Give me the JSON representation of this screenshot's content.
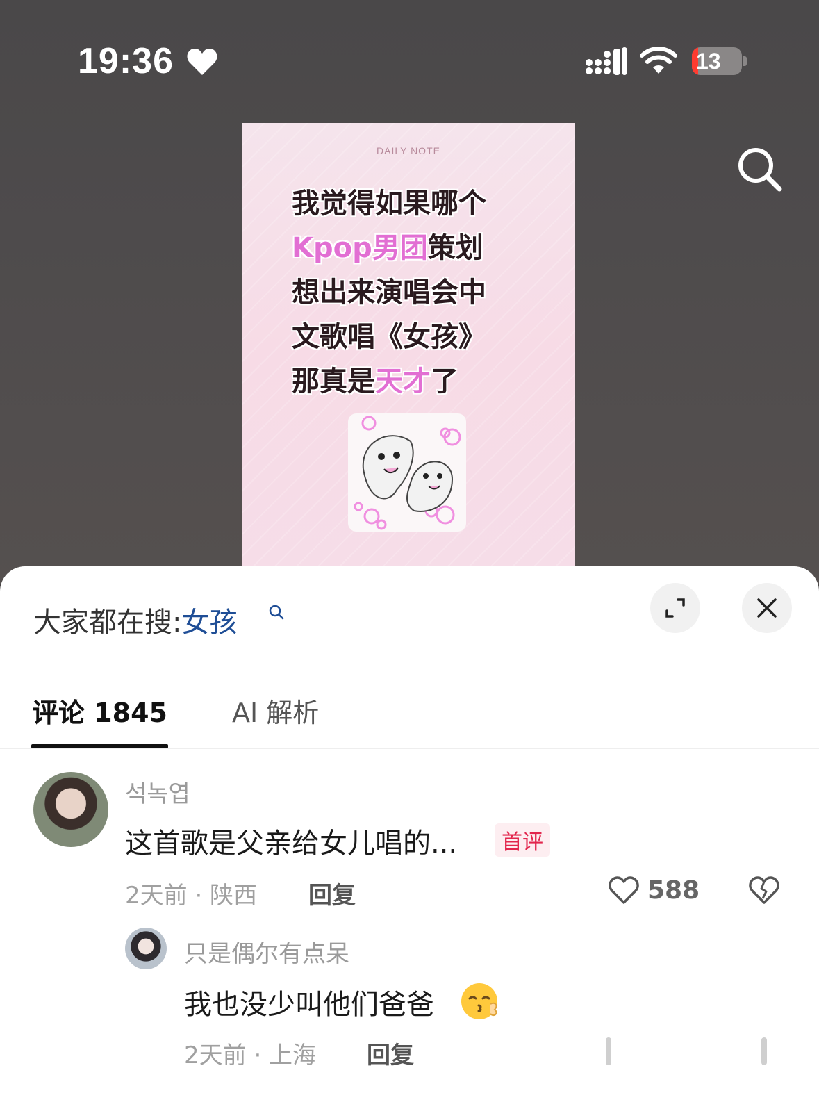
{
  "status_bar": {
    "time": "19:36",
    "battery": "13",
    "battery_level": 0.13
  },
  "post": {
    "header": "DAILY  NOTE",
    "lines": [
      [
        {
          "t": "我觉得如果哪个",
          "h": false
        }
      ],
      [
        {
          "t": "Kpop男团",
          "h": true
        },
        {
          "t": "策划",
          "h": false
        }
      ],
      [
        {
          "t": "想出来演唱会中",
          "h": false
        }
      ],
      [
        {
          "t": "文歌唱《女孩》",
          "h": false
        }
      ],
      [
        {
          "t": "那真是",
          "h": false
        },
        {
          "t": "天才",
          "h": true
        },
        {
          "t": "了",
          "h": false
        }
      ]
    ]
  },
  "sheet": {
    "search_prefix": "大家都在搜:",
    "search_keyword": "女孩",
    "tabs": {
      "comments": "评论 1845",
      "ai": "AI 解析"
    }
  },
  "comments": [
    {
      "user": "석녹엽",
      "text": "这首歌是父亲给女儿唱的...",
      "badge": "首评",
      "meta": "2天前 · 陕西",
      "reply": "回复",
      "likes": "588"
    },
    {
      "user": "只是偶尔有点呆",
      "text": "我也没少叫他们爸爸",
      "meta": "2天前 · 上海",
      "reply": "回复"
    }
  ],
  "colors": {
    "highlight": "#e26fd3",
    "keyword": "#1f4e96",
    "badge": "#e2264d"
  }
}
